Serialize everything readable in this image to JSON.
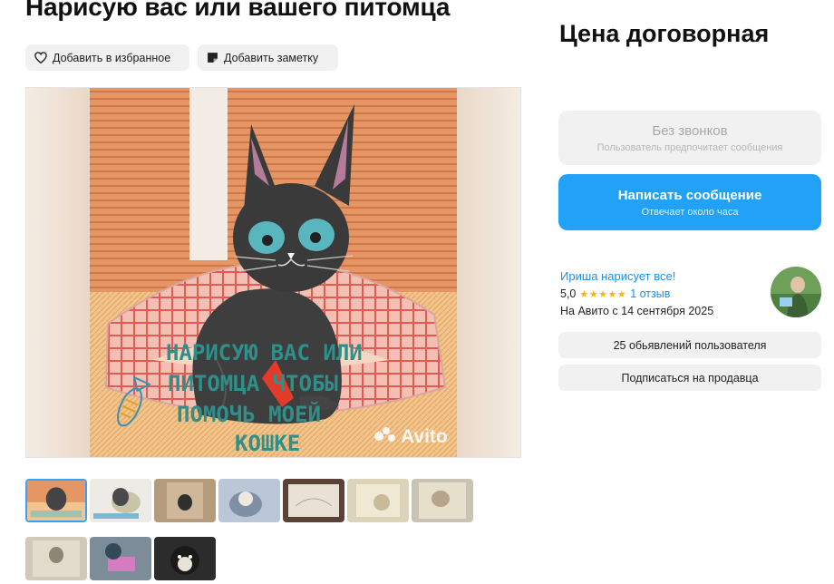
{
  "listing": {
    "title": "Нарисую вас или вашего питомца",
    "actions": {
      "favorite_label": "Добавить в избранное",
      "note_label": "Добавить заметку"
    },
    "gallery": {
      "watermark": "Avito",
      "drawing_caption": [
        "НАРИСУЮ ВАС ИЛИ",
        "ПИТОМЦА ЧТОБЫ",
        "ПОМОЧЬ МОЕЙ",
        "КОШКЕ"
      ],
      "thumbnail_count": 10,
      "active_thumbnail": 1
    }
  },
  "sidebar": {
    "price": "Цена договорная",
    "no_calls": {
      "title": "Без звонков",
      "subtitle": "Пользователь предпочитает сообщения"
    },
    "write": {
      "title": "Написать сообщение",
      "subtitle": "Отвечает около часа"
    },
    "seller": {
      "name": "Ириша нарисует все!",
      "rating": "5,0",
      "stars": "★★★★★",
      "reviews": "1 отзыв",
      "since": "На Авито с 14 сентября 2025"
    },
    "ads_button": "25 обьявлений пользователя",
    "subscribe_button": "Подписаться на продавца"
  },
  "colors": {
    "accent": "#21a2f7",
    "link": "#1a8fe6",
    "star": "#f6b600",
    "chip_bg": "#f1f1f1"
  },
  "icons": {
    "favorite": "heart-icon",
    "note": "note-icon"
  }
}
